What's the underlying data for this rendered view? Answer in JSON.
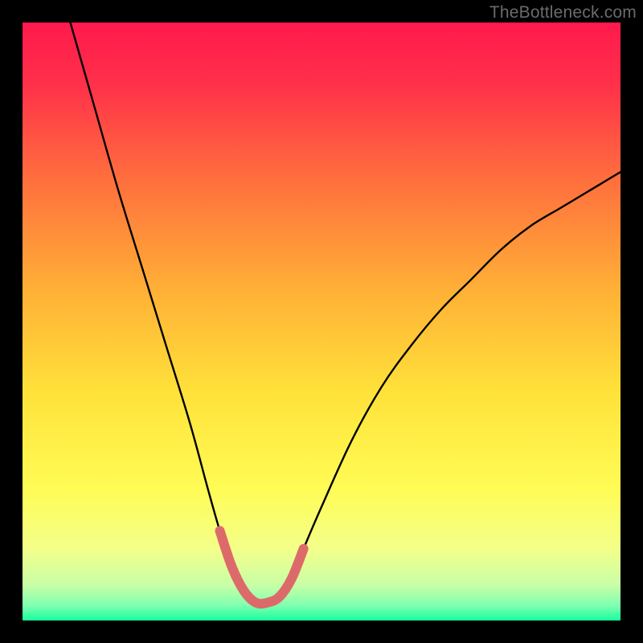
{
  "watermark": {
    "text": "TheBottleneck.com"
  },
  "colors": {
    "gradient_stops": [
      {
        "offset": 0.0,
        "color": "#ff1a4d"
      },
      {
        "offset": 0.1,
        "color": "#ff2f4a"
      },
      {
        "offset": 0.25,
        "color": "#ff6a3e"
      },
      {
        "offset": 0.45,
        "color": "#ffb136"
      },
      {
        "offset": 0.62,
        "color": "#ffe23a"
      },
      {
        "offset": 0.78,
        "color": "#fffc55"
      },
      {
        "offset": 0.88,
        "color": "#f4ff8a"
      },
      {
        "offset": 0.94,
        "color": "#c9ffa6"
      },
      {
        "offset": 0.975,
        "color": "#7fffb0"
      },
      {
        "offset": 1.0,
        "color": "#19ff9e"
      }
    ],
    "curve_stroke": "#000000",
    "highlight_stroke": "#dd6a6a",
    "background_frame": "#000000"
  },
  "chart_data": {
    "type": "line",
    "title": "",
    "xlabel": "",
    "ylabel": "",
    "xlim": [
      0,
      100
    ],
    "ylim": [
      0,
      100
    ],
    "grid": false,
    "legend": false,
    "optimum_x": 40,
    "series": [
      {
        "name": "bottleneck-curve",
        "x": [
          8,
          12,
          16,
          20,
          24,
          28,
          31,
          33,
          35,
          37,
          39,
          41,
          43,
          45,
          47,
          50,
          55,
          60,
          65,
          70,
          75,
          80,
          85,
          90,
          95,
          100
        ],
        "y": [
          100,
          86,
          72,
          59,
          46,
          33,
          22,
          15,
          9,
          5,
          3,
          3,
          4,
          7,
          12,
          19,
          30,
          39,
          46,
          52,
          57,
          62,
          66,
          69,
          72,
          75
        ]
      }
    ],
    "highlight_segment": {
      "x": [
        33,
        35,
        37,
        39,
        41,
        43,
        45,
        47
      ],
      "y": [
        15,
        9,
        5,
        3,
        3,
        4,
        7,
        12
      ]
    }
  }
}
